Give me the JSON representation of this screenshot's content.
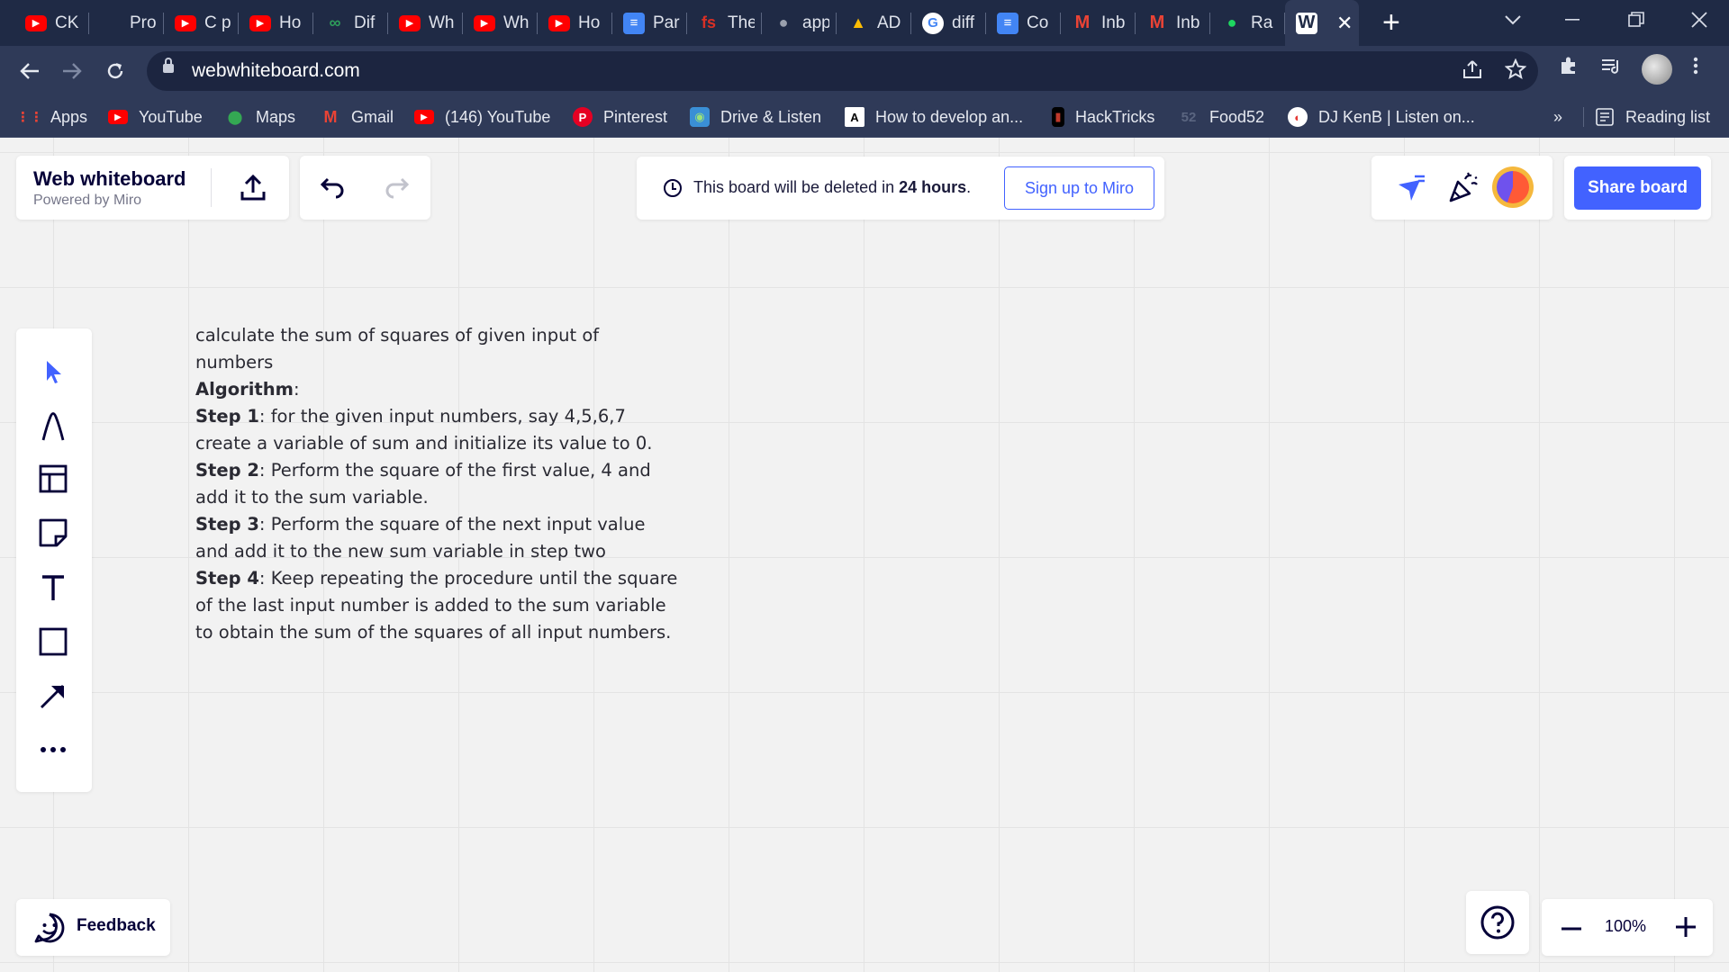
{
  "browser": {
    "tabs": [
      {
        "title": "CK",
        "icon": "youtube-icon",
        "color": "#ff0000"
      },
      {
        "title": "Pro",
        "icon": "dark-icon",
        "color": "#1f2a45"
      },
      {
        "title": "C p",
        "icon": "youtube-icon",
        "color": "#ff0000"
      },
      {
        "title": "Ho",
        "icon": "youtube-icon",
        "color": "#ff0000"
      },
      {
        "title": "Dif",
        "icon": "link-icon",
        "color": "#2e9e5b"
      },
      {
        "title": "Wh",
        "icon": "youtube-icon",
        "color": "#ff0000"
      },
      {
        "title": "Wh",
        "icon": "youtube-icon",
        "color": "#ff0000"
      },
      {
        "title": "Ho",
        "icon": "youtube-icon",
        "color": "#ff0000"
      },
      {
        "title": "Par",
        "icon": "docs-icon",
        "color": "#4285f4"
      },
      {
        "title": "The",
        "icon": "fs-icon",
        "color": "#d93025"
      },
      {
        "title": "app",
        "icon": "globe-icon",
        "color": "#9aa0ad"
      },
      {
        "title": "AD",
        "icon": "drive-icon",
        "color": "#fbbc04"
      },
      {
        "title": "diff",
        "icon": "google-icon",
        "color": "#ffffff"
      },
      {
        "title": "Co",
        "icon": "docs-icon",
        "color": "#4285f4"
      },
      {
        "title": "Inb",
        "icon": "gmail-icon",
        "color": "#ea4335"
      },
      {
        "title": "Inb",
        "icon": "gmail-icon",
        "color": "#ea4335"
      },
      {
        "title": "Ra",
        "icon": "dot-icon",
        "color": "#1ed760"
      }
    ],
    "active_tab": {
      "letter": "W",
      "close": "✕"
    },
    "new_tab": "+",
    "url": "webwhiteboard.com",
    "bookmarks": [
      {
        "label": "Apps",
        "icon": "apps-icon",
        "color": "#ea4335"
      },
      {
        "label": "YouTube",
        "icon": "youtube-icon",
        "color": "#ff0000"
      },
      {
        "label": "Maps",
        "icon": "maps-icon",
        "color": "#34a853"
      },
      {
        "label": "Gmail",
        "icon": "gmail-icon",
        "color": "#ea4335"
      },
      {
        "label": "(146) YouTube",
        "icon": "youtube-icon",
        "color": "#ff0000"
      },
      {
        "label": "Pinterest",
        "icon": "pinterest-icon",
        "color": "#e60023"
      },
      {
        "label": "Drive & Listen",
        "icon": "drive-listen-icon",
        "color": "#3a8fd6"
      },
      {
        "label": "How to develop an...",
        "icon": "ai-icon",
        "color": "#ffffff"
      },
      {
        "label": "HackTricks",
        "icon": "hacktricks-icon",
        "color": "#000000"
      },
      {
        "label": "Food52",
        "icon": "food52-icon",
        "color": "#5a6580"
      },
      {
        "label": "DJ KenB | Listen on...",
        "icon": "dj-icon",
        "color": "#ffffff"
      }
    ],
    "bookmarks_overflow": "»",
    "reading_list": "Reading list"
  },
  "board": {
    "brand_title": "Web whiteboard",
    "brand_sub": "Powered by Miro",
    "notice_prefix": "This board will be deleted in ",
    "notice_bold": "24 hours",
    "notice_suffix": ".",
    "signup_label": "Sign up to Miro",
    "share_label": "Share board",
    "feedback_label": "Feedback",
    "zoom_level": "100%",
    "accent": "#4262ff",
    "note": {
      "intro": "calculate the sum of squares of given input of numbers",
      "algo_label": "Algorithm",
      "algo_suffix": ":",
      "steps": [
        {
          "label": "Step 1",
          "text": ": for the given input numbers, say 4,5,6,7 create a variable of sum and initialize its value to 0."
        },
        {
          "label": "Step 2",
          "text": ": Perform the square of the first value, 4 and add it to the sum variable."
        },
        {
          "label": "Step 3",
          "text": ": Perform the square of the next input value and add it to the new sum variable in step two"
        },
        {
          "label": "Step 4",
          "text": ":  Keep repeating the procedure until the square of the last input number is added to the sum variable to obtain the sum of the squares of all input numbers."
        }
      ]
    }
  }
}
